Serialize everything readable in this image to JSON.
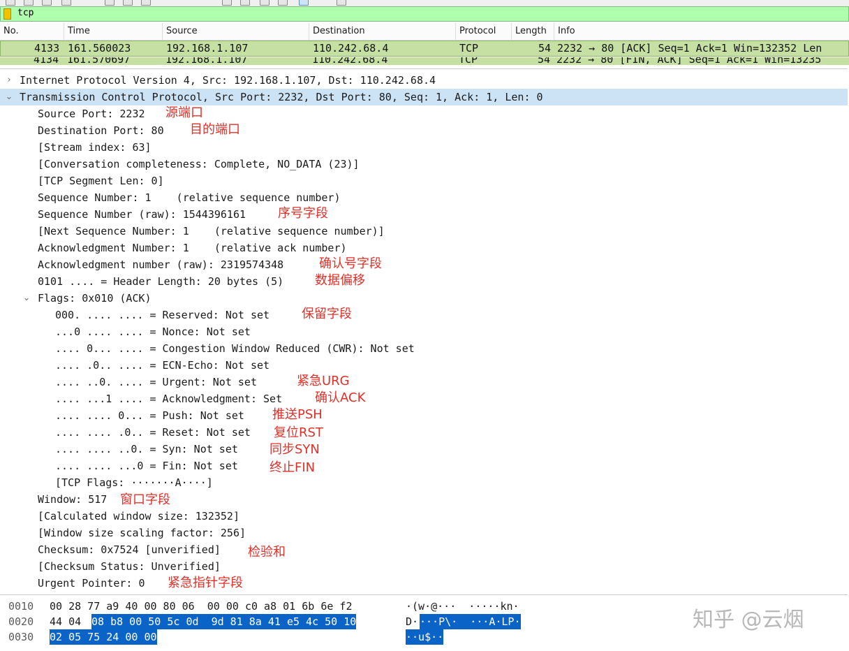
{
  "filter": {
    "value": "tcp"
  },
  "packet_list": {
    "columns": [
      "No.",
      "Time",
      "Source",
      "Destination",
      "Protocol",
      "Length",
      "Info"
    ],
    "rows": [
      {
        "no": "4133",
        "time": "161.560023",
        "source": "192.168.1.107",
        "destination": "110.242.68.4",
        "protocol": "TCP",
        "length": "54",
        "info": "2232 → 80 [ACK] Seq=1 Ack=1 Win=132352 Len"
      },
      {
        "no": "4134",
        "time": "161.570697",
        "source": "192.168.1.107",
        "destination": "110.242.68.4",
        "protocol": "TCP",
        "length": "54",
        "info": "2232 → 80 [FIN, ACK] Seq=1 Ack=1 Win=13235"
      }
    ]
  },
  "details": {
    "ip": "Internet Protocol Version 4, Src: 192.168.1.107, Dst: 110.242.68.4",
    "tcp": "Transmission Control Protocol, Src Port: 2232, Dst Port: 80, Seq: 1, Ack: 1, Len: 0",
    "fields": [
      {
        "text": "Source Port: 2232",
        "note": "源端口"
      },
      {
        "text": "Destination Port: 80",
        "note": "目的端口"
      },
      {
        "text": "[Stream index: 63]",
        "note": ""
      },
      {
        "text": "[Conversation completeness: Complete, NO_DATA (23)]",
        "note": ""
      },
      {
        "text": "[TCP Segment Len: 0]",
        "note": ""
      },
      {
        "text": "Sequence Number: 1    (relative sequence number)",
        "note": ""
      },
      {
        "text": "Sequence Number (raw): 1544396161",
        "note": "序号字段"
      },
      {
        "text": "[Next Sequence Number: 1    (relative sequence number)]",
        "note": ""
      },
      {
        "text": "Acknowledgment Number: 1    (relative ack number)",
        "note": ""
      },
      {
        "text": "Acknowledgment number (raw): 2319574348",
        "note": "确认号字段"
      },
      {
        "text": "0101 .... = Header Length: 20 bytes (5)",
        "note": "数据偏移"
      }
    ],
    "flags_header": "Flags: 0x010 (ACK)",
    "flags": [
      {
        "text": "000. .... .... = Reserved: Not set",
        "note": "保留字段"
      },
      {
        "text": "...0 .... .... = Nonce: Not set",
        "note": ""
      },
      {
        "text": ".... 0... .... = Congestion Window Reduced (CWR): Not set",
        "note": ""
      },
      {
        "text": ".... .0.. .... = ECN-Echo: Not set",
        "note": ""
      },
      {
        "text": ".... ..0. .... = Urgent: Not set",
        "note": "紧急URG"
      },
      {
        "text": ".... ...1 .... = Acknowledgment: Set",
        "note": "确认ACK"
      },
      {
        "text": ".... .... 0... = Push: Not set",
        "note": "推送PSH"
      },
      {
        "text": ".... .... .0.. = Reset: Not set",
        "note": "复位RST"
      },
      {
        "text": ".... .... ..0. = Syn: Not set",
        "note": "同步SYN"
      },
      {
        "text": ".... .... ...0 = Fin: Not set",
        "note": "终止FIN"
      },
      {
        "text": "[TCP Flags: ·······A····]",
        "note": ""
      }
    ],
    "tail": [
      {
        "text": "Window: 517",
        "note": "窗口字段"
      },
      {
        "text": "[Calculated window size: 132352]",
        "note": ""
      },
      {
        "text": "[Window size scaling factor: 256]",
        "note": ""
      },
      {
        "text": "Checksum: 0x7524 [unverified]",
        "note": "检验和"
      },
      {
        "text": "[Checksum Status: Unverified]",
        "note": ""
      },
      {
        "text": "Urgent Pointer: 0",
        "note": "紧急指针字段"
      }
    ]
  },
  "bytes": {
    "offsets": [
      "0010",
      "0020",
      "0030"
    ],
    "hex": {
      "l0": "00 28 77 a9 40 00 80 06  00 00 c0 a8 01 6b 6e f2",
      "l1a": "44 04",
      "l1b": "08 b8 00 50 5c 0d  9d 81 8a 41 e5 4c 50 10",
      "l2": "02 05 75 24 00 00"
    },
    "ascii": {
      "l0": "·(w·@···  ·····kn·",
      "l1a": "D·",
      "l1b": "···P\\·  ···A·LP·",
      "l2": "··u$··"
    }
  },
  "watermark": "知乎 @云烟",
  "colors": {
    "filter_bg": "#afffaf",
    "row_bg": "#c6e0a4",
    "selected": "#cce3f6",
    "annotation": "#e0302a",
    "byte_highlight": "#0a64c8"
  }
}
